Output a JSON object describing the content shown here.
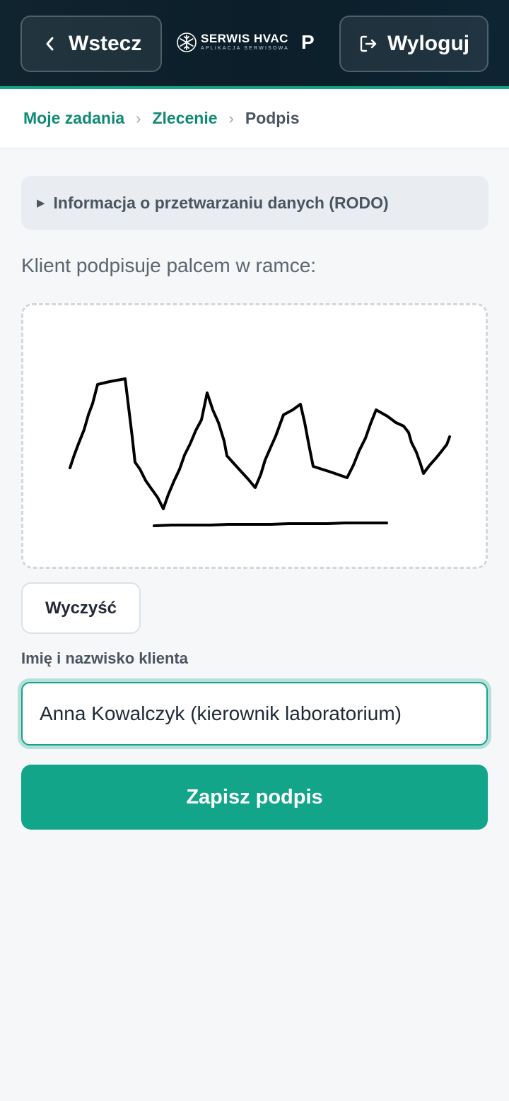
{
  "header": {
    "back_label": "Wstecz",
    "brand_name": "SERWIS HVAC",
    "brand_sub": "APLIKACJA SERWISOWA",
    "user_initial": "P",
    "logout_label": "Wyloguj"
  },
  "breadcrumb": {
    "items": [
      "Moje zadania",
      "Zlecenie"
    ],
    "current": "Podpis"
  },
  "rodo": {
    "summary": "Informacja o przetwarzaniu danych (RODO)"
  },
  "signature": {
    "instruction": "Klient podpisuje palcem w ramce:",
    "clear_label": "Wyczyść"
  },
  "client": {
    "name_label": "Imię i nazwisko klienta",
    "name_value": "Anna Kowalczyk (kierownik laboratorium)"
  },
  "actions": {
    "save_label": "Zapisz podpis"
  },
  "colors": {
    "accent": "#12a58a",
    "header_bg": "#10242f",
    "link": "#0f8a74"
  }
}
